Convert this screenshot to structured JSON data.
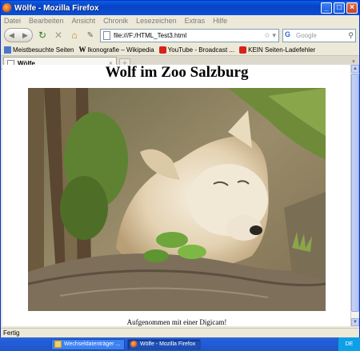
{
  "window": {
    "title": "Wölfe - Mozilla Firefox",
    "controls": {
      "minimize": "_",
      "maximize": "□",
      "close": "×"
    }
  },
  "menu": [
    "Datei",
    "Bearbeiten",
    "Ansicht",
    "Chronik",
    "Lesezeichen",
    "Extras",
    "Hilfe"
  ],
  "nav": {
    "back_icon": "back-arrow-icon",
    "forward_icon": "forward-arrow-icon",
    "url": "file:///F:/HTML_Test3.html",
    "search_placeholder": "Google"
  },
  "bookmarks": [
    {
      "label": "Meistbesuchte Seiten",
      "icon": "bookmark-icon"
    },
    {
      "label": "Ikonografie – Wikipedia",
      "icon": "wikipedia-icon"
    },
    {
      "label": "YouTube - Broadcast ...",
      "icon": "youtube-icon"
    },
    {
      "label": "KEIN Seiten-Ladefehler",
      "icon": "youtube-icon"
    }
  ],
  "tabs": [
    {
      "label": "Wölfe",
      "active": true
    }
  ],
  "page": {
    "heading": "Wolf im Zoo Salzburg",
    "image_alt": "white wolf resting on a log",
    "caption": "Aufgenommen mit einer Digicam!"
  },
  "status": "Fertig",
  "taskbar": {
    "tasks": [
      {
        "label": "Wechseldatenträger ...",
        "icon": "folder-icon",
        "active": false
      },
      {
        "label": "Wölfe - Mozilla Firefox",
        "icon": "firefox-icon",
        "active": true
      }
    ],
    "tray": "DE"
  }
}
